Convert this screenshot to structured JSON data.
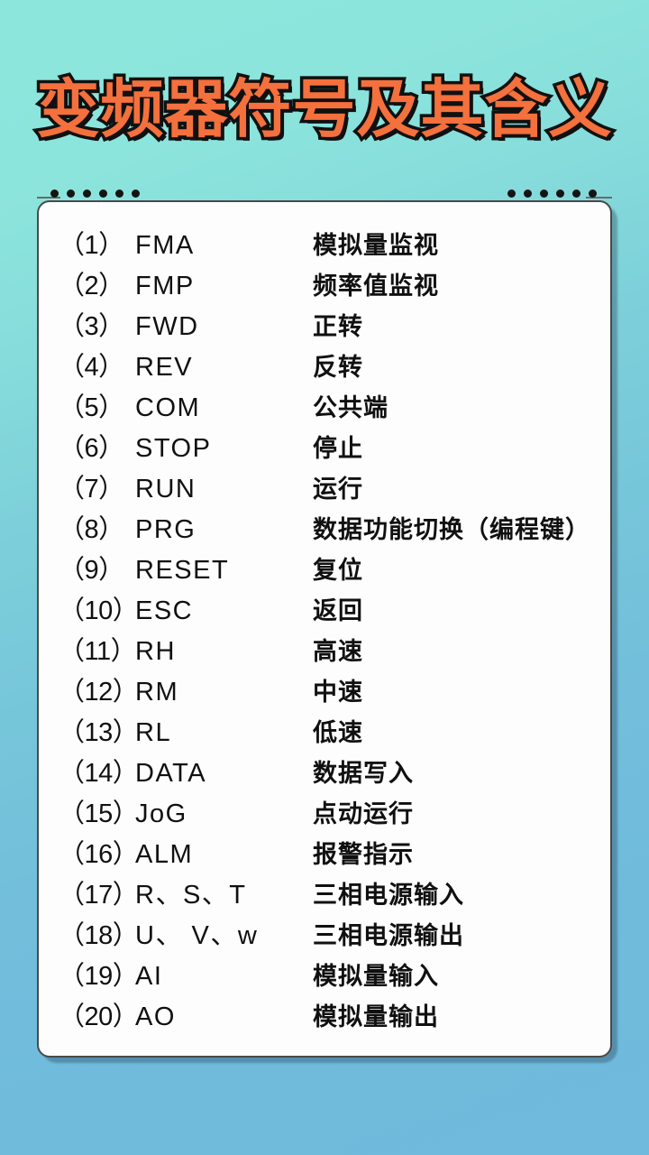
{
  "title": "变频器符号及其含义",
  "colors": {
    "title_fill": "#f4703c",
    "title_outline": "#111111",
    "bg_top": "#8ce6dc",
    "bg_bottom": "#6fbadd",
    "card_bg": "#fdfdfd",
    "card_border": "#4a4a4a",
    "text": "#101010"
  },
  "decoration": {
    "dot_count_left": 6,
    "dot_count_right": 6
  },
  "list": [
    {
      "num": "（1）",
      "code": "FMA",
      "meaning": "模拟量监视"
    },
    {
      "num": "（2）",
      "code": "FMP",
      "meaning": "频率值监视"
    },
    {
      "num": "（3）",
      "code": "FWD",
      "meaning": "正转"
    },
    {
      "num": "（4）",
      "code": "REV",
      "meaning": "反转"
    },
    {
      "num": "（5）",
      "code": "COM",
      "meaning": "公共端"
    },
    {
      "num": "（6）",
      "code": "STOP",
      "meaning": "停止"
    },
    {
      "num": "（7）",
      "code": "RUN",
      "meaning": "运行"
    },
    {
      "num": "（8）",
      "code": "PRG",
      "meaning": "数据功能切换（编程键）"
    },
    {
      "num": "（9）",
      "code": "RESET",
      "meaning": "复位"
    },
    {
      "num": "（10）",
      "code": "ESC",
      "meaning": "返回"
    },
    {
      "num": "（11）",
      "code": "RH",
      "meaning": "高速"
    },
    {
      "num": "（12）",
      "code": "RM",
      "meaning": "中速"
    },
    {
      "num": "（13）",
      "code": " RL",
      "meaning": "低速"
    },
    {
      "num": "（14）",
      "code": "DATA",
      "meaning": "数据写入"
    },
    {
      "num": "（15）",
      "code": "JoG",
      "meaning": "点动运行"
    },
    {
      "num": "（16）",
      "code": "ALM",
      "meaning": "报警指示"
    },
    {
      "num": "（17）",
      "code": "R、S、T",
      "meaning": "三相电源输入"
    },
    {
      "num": "（18）",
      "code": "U、 V、w",
      "meaning": "三相电源输出"
    },
    {
      "num": "（19）",
      "code": "AI",
      "meaning": "模拟量输入"
    },
    {
      "num": "（20）",
      "code": "AO",
      "meaning": "模拟量输出"
    }
  ]
}
